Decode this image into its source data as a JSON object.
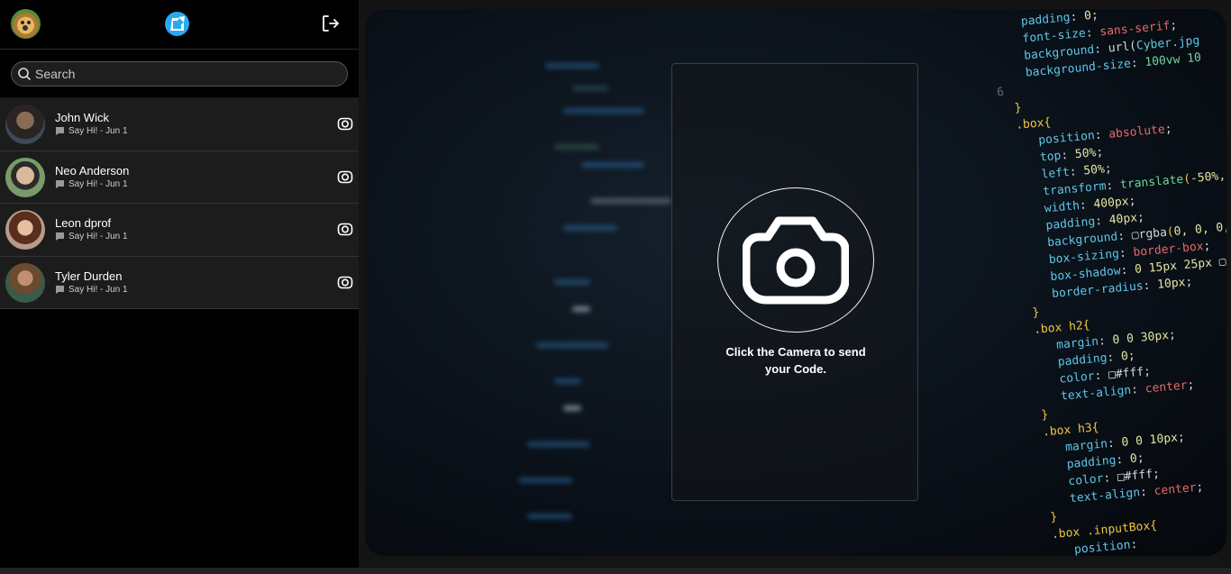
{
  "sidebar": {
    "search": {
      "placeholder": "Search"
    },
    "contacts": [
      {
        "name": "John Wick",
        "preview": "Say Hi! - Jun 1"
      },
      {
        "name": "Neo Anderson",
        "preview": "Say Hi! - Jun 1"
      },
      {
        "name": "Leon dprof",
        "preview": "Say Hi! - Jun 1"
      },
      {
        "name": "Tyler Durden",
        "preview": "Say Hi! - Jun 1"
      }
    ]
  },
  "main": {
    "cta_line1": "Click the Camera to send",
    "cta_line2": "your Code."
  },
  "icons": {
    "logo": "chat-logo-icon",
    "logout": "logout-icon",
    "search": "search-icon",
    "message": "message-icon",
    "camera": "camera-icon"
  },
  "colors": {
    "accent": "#2aa8f0",
    "sidebar_bg": "#000000",
    "row_bg": "#1c1c1c"
  }
}
